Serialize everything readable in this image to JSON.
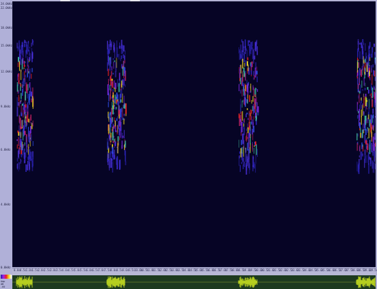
{
  "app": {
    "freq_labels": [
      "24.0kHz",
      "22.0kHz",
      "18.0kHz",
      "15.0kHz",
      "12.0kHz",
      "9.0kHz",
      "6.0kHz",
      "4.0kHz",
      "0.0kHz"
    ],
    "time_ticks": [
      "0.0s",
      "0.5s",
      "1.0s",
      "1.5s",
      "2.0s",
      "2.5s",
      "3.0s",
      "3.5s",
      "4.0s",
      "4.5s",
      "5.0s",
      "5.5s",
      "6.0s",
      "6.5s",
      "7.0s",
      "7.5s",
      "8.0s",
      "8.5s",
      "9.0s",
      "9.5s",
      "10.0s",
      "10.5s",
      "11.0s",
      "11.5s",
      "12.0s",
      "12.5s",
      "13.0s",
      "13.5s",
      "14.0s",
      "14.5s",
      "15.0s",
      "15.5s",
      "16.0s",
      "16.5s",
      "17.0s",
      "17.5s",
      "18.0s",
      "18.5s",
      "19.0s",
      "19.5s",
      "20.0s",
      "20.5s",
      "21.0s",
      "21.5s",
      "22.0s",
      "22.5s",
      "23.0s",
      "23.5s",
      "24.0s",
      "24.5s",
      "25.0s",
      "25.5s",
      "26.0s",
      "26.5s",
      "27.0s",
      "27.5s",
      "28.0s",
      "28.5s",
      "29.0s",
      "29.5s"
    ],
    "wave_labels": [
      "Amp",
      "dB",
      "-60"
    ],
    "colors": {
      "background": "#060425",
      "wave_bg": "#1d3a1f",
      "wave": "#d8f020"
    }
  }
}
